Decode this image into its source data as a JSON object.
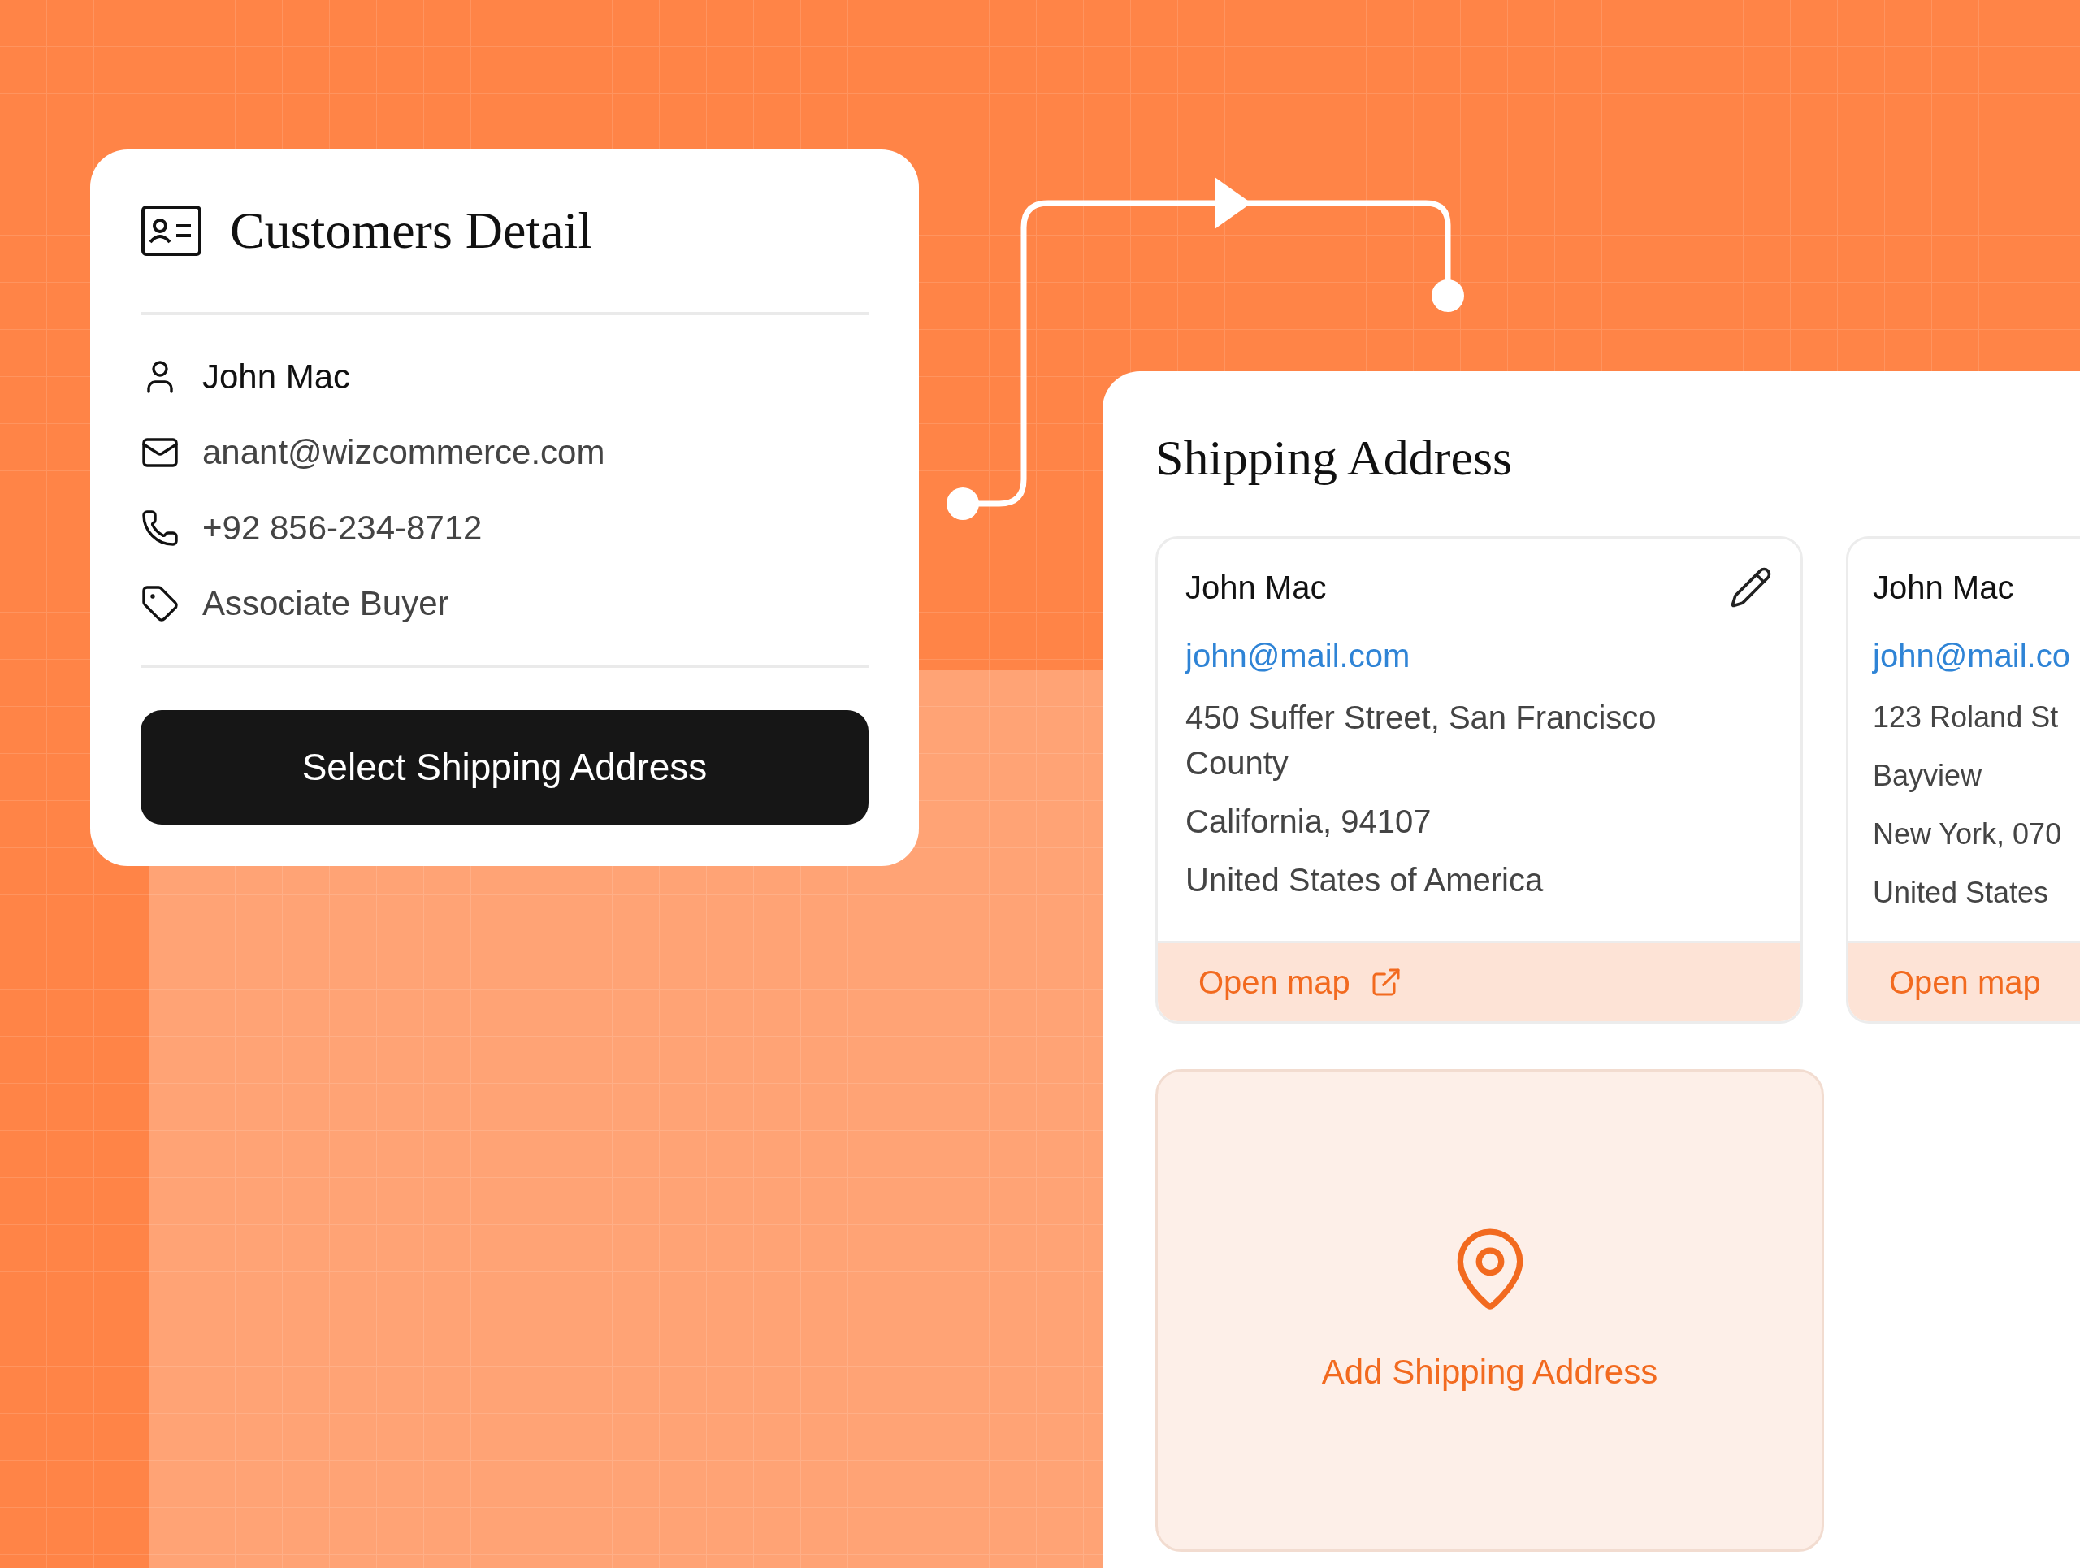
{
  "customer_card": {
    "title": "Customers Detail",
    "name": "John Mac",
    "email": "anant@wizcommerce.com",
    "phone": "+92 856-234-8712",
    "role": "Associate Buyer",
    "button": "Select Shipping Address"
  },
  "shipping_panel": {
    "title": "Shipping Address",
    "addresses": [
      {
        "kind": "full",
        "name": "John Mac",
        "email": "john@mail.com",
        "lines": [
          "450 Suffer Street, San Francisco County",
          "California, 94107",
          "United States of America"
        ],
        "link": "Open map"
      },
      {
        "kind": "cropped",
        "name": "John Mac",
        "email": "john@mail.co",
        "lines": [
          "123 Roland St",
          "Bayview",
          "New York, 070",
          "United States"
        ],
        "link": "Open map"
      }
    ],
    "add_button": "Add Shipping Address"
  }
}
